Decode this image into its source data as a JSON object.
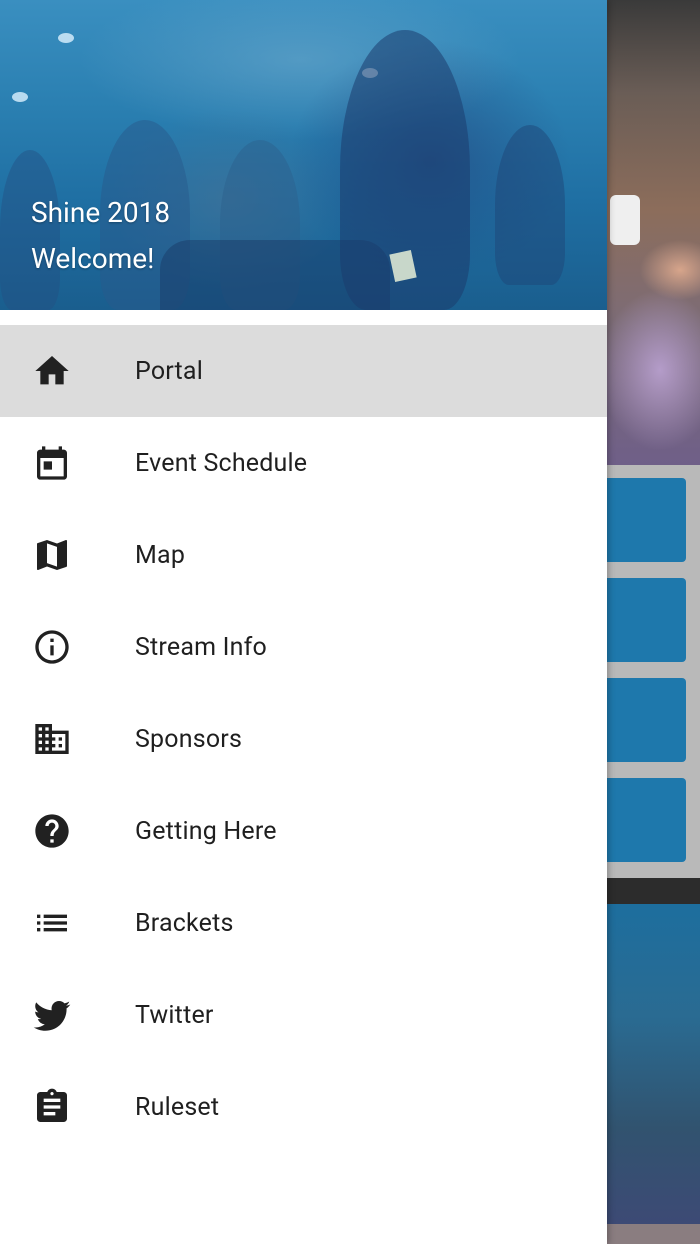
{
  "drawer": {
    "header": {
      "title": "Shine 2018",
      "subtitle": "Welcome!"
    },
    "items": [
      {
        "label": "Portal",
        "icon": "home-icon",
        "active": true
      },
      {
        "label": "Event Schedule",
        "icon": "calendar-icon",
        "active": false
      },
      {
        "label": "Map",
        "icon": "map-icon",
        "active": false
      },
      {
        "label": "Stream Info",
        "icon": "info-icon",
        "active": false
      },
      {
        "label": "Sponsors",
        "icon": "building-icon",
        "active": false
      },
      {
        "label": "Getting Here",
        "icon": "help-icon",
        "active": false
      },
      {
        "label": "Brackets",
        "icon": "list-icon",
        "active": false
      },
      {
        "label": "Twitter",
        "icon": "twitter-icon",
        "active": false
      },
      {
        "label": "Ruleset",
        "icon": "clipboard-icon",
        "active": false
      }
    ]
  },
  "colors": {
    "accent": "#1e78ac",
    "active_item_bg": "#dcdcdc",
    "text": "#1f1f1f",
    "icon": "#212121"
  }
}
